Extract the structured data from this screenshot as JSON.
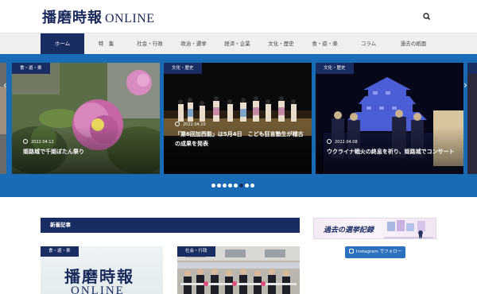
{
  "header": {
    "logo_kanji": "播磨時報",
    "logo_en": "ONLINE"
  },
  "nav": {
    "items": [
      {
        "label": "ホーム",
        "active": true
      },
      {
        "label": "特　集"
      },
      {
        "label": "社会・行政"
      },
      {
        "label": "政治・選挙"
      },
      {
        "label": "経済・企業"
      },
      {
        "label": "文化・歴史"
      },
      {
        "label": "食・遊・楽"
      },
      {
        "label": "コラム"
      },
      {
        "label": "過去の紙面"
      }
    ]
  },
  "slider": {
    "cards": [
      {
        "category": "食・遊・楽",
        "date": "2022.04.12",
        "title": "姫路城で千姫ぼたん祭り"
      },
      {
        "category": "文化・歴史",
        "date": "2022.04.10",
        "title": "「第6回加西能」は5月4日　こども狂言塾生が稽古の成果を発表"
      },
      {
        "category": "文化・歴史",
        "date": "2022.04.08",
        "title": "ウクライナ戦火の終息を祈り、姫路城でコンサート"
      }
    ],
    "dots": 8,
    "active_dot": 5
  },
  "latest": {
    "heading": "新着記事",
    "thumbs": [
      {
        "category": "食・遊・楽",
        "logo_kanji": "播磨時報",
        "logo_en": "ONLINE"
      },
      {
        "category": "社会・行政"
      }
    ]
  },
  "sidebar": {
    "banner_text": "過去の選挙記録",
    "instagram_label": "Instagram でフォロー"
  },
  "colors": {
    "navy": "#1a2d63",
    "blue_band": "#1a6bb6",
    "instagram": "#2c71bd"
  }
}
